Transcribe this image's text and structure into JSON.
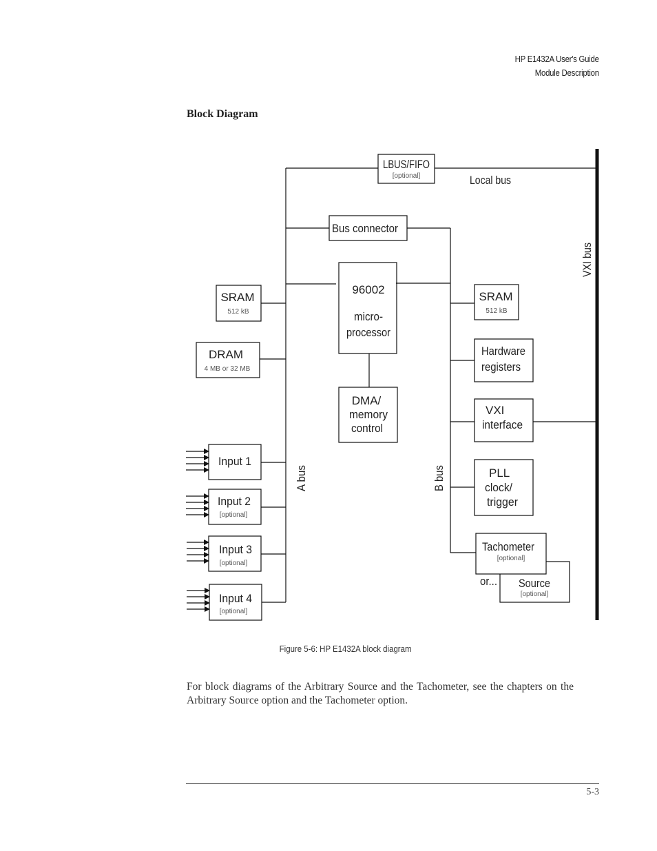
{
  "header": {
    "line1": "HP E1432A User's Guide",
    "line2": "Module Description"
  },
  "section_title": "Block Diagram",
  "diagram": {
    "blocks": {
      "lbus_fifo": {
        "label": "LBUS/FIFO",
        "sub": "[optional]"
      },
      "bus_connector": {
        "label": "Bus connector"
      },
      "microprocessor": {
        "line1": "96002",
        "line2": "micro-",
        "line3": "processor"
      },
      "dma": {
        "line1": "DMA/",
        "line2": "memory",
        "line3": "control"
      },
      "sram_a": {
        "label": "SRAM",
        "sub": "512 kB"
      },
      "dram": {
        "label": "DRAM",
        "sub": "4 MB or 32 MB"
      },
      "input1": {
        "label": "Input 1"
      },
      "input2": {
        "label": "Input 2",
        "sub": "[optional]"
      },
      "input3": {
        "label": "Input 3",
        "sub": "[optional]"
      },
      "input4": {
        "label": "Input 4",
        "sub": "[optional]"
      },
      "sram_b": {
        "label": "SRAM",
        "sub": "512 kB"
      },
      "hw_registers": {
        "line1": "Hardware",
        "line2": "registers"
      },
      "vxi_interface": {
        "line1": "VXI",
        "line2": "interface"
      },
      "pll": {
        "line1": "PLL",
        "line2": "clock/",
        "line3": "trigger"
      },
      "tachometer": {
        "label": "Tachometer",
        "sub": "[optional]"
      },
      "source": {
        "label": "Source",
        "sub": "[optional]"
      }
    },
    "labels": {
      "local_bus": "Local bus",
      "vxi_bus": "VXI bus",
      "a_bus": "A bus",
      "b_bus": "B bus",
      "or": "or..."
    }
  },
  "caption": "Figure 5-6:  HP E1432A block diagram",
  "paragraph": "For block diagrams of the Arbitrary Source and the Tachometer, see the chapters on the Arbitrary Source option and the Tachometer option.",
  "page_number": "5-3"
}
